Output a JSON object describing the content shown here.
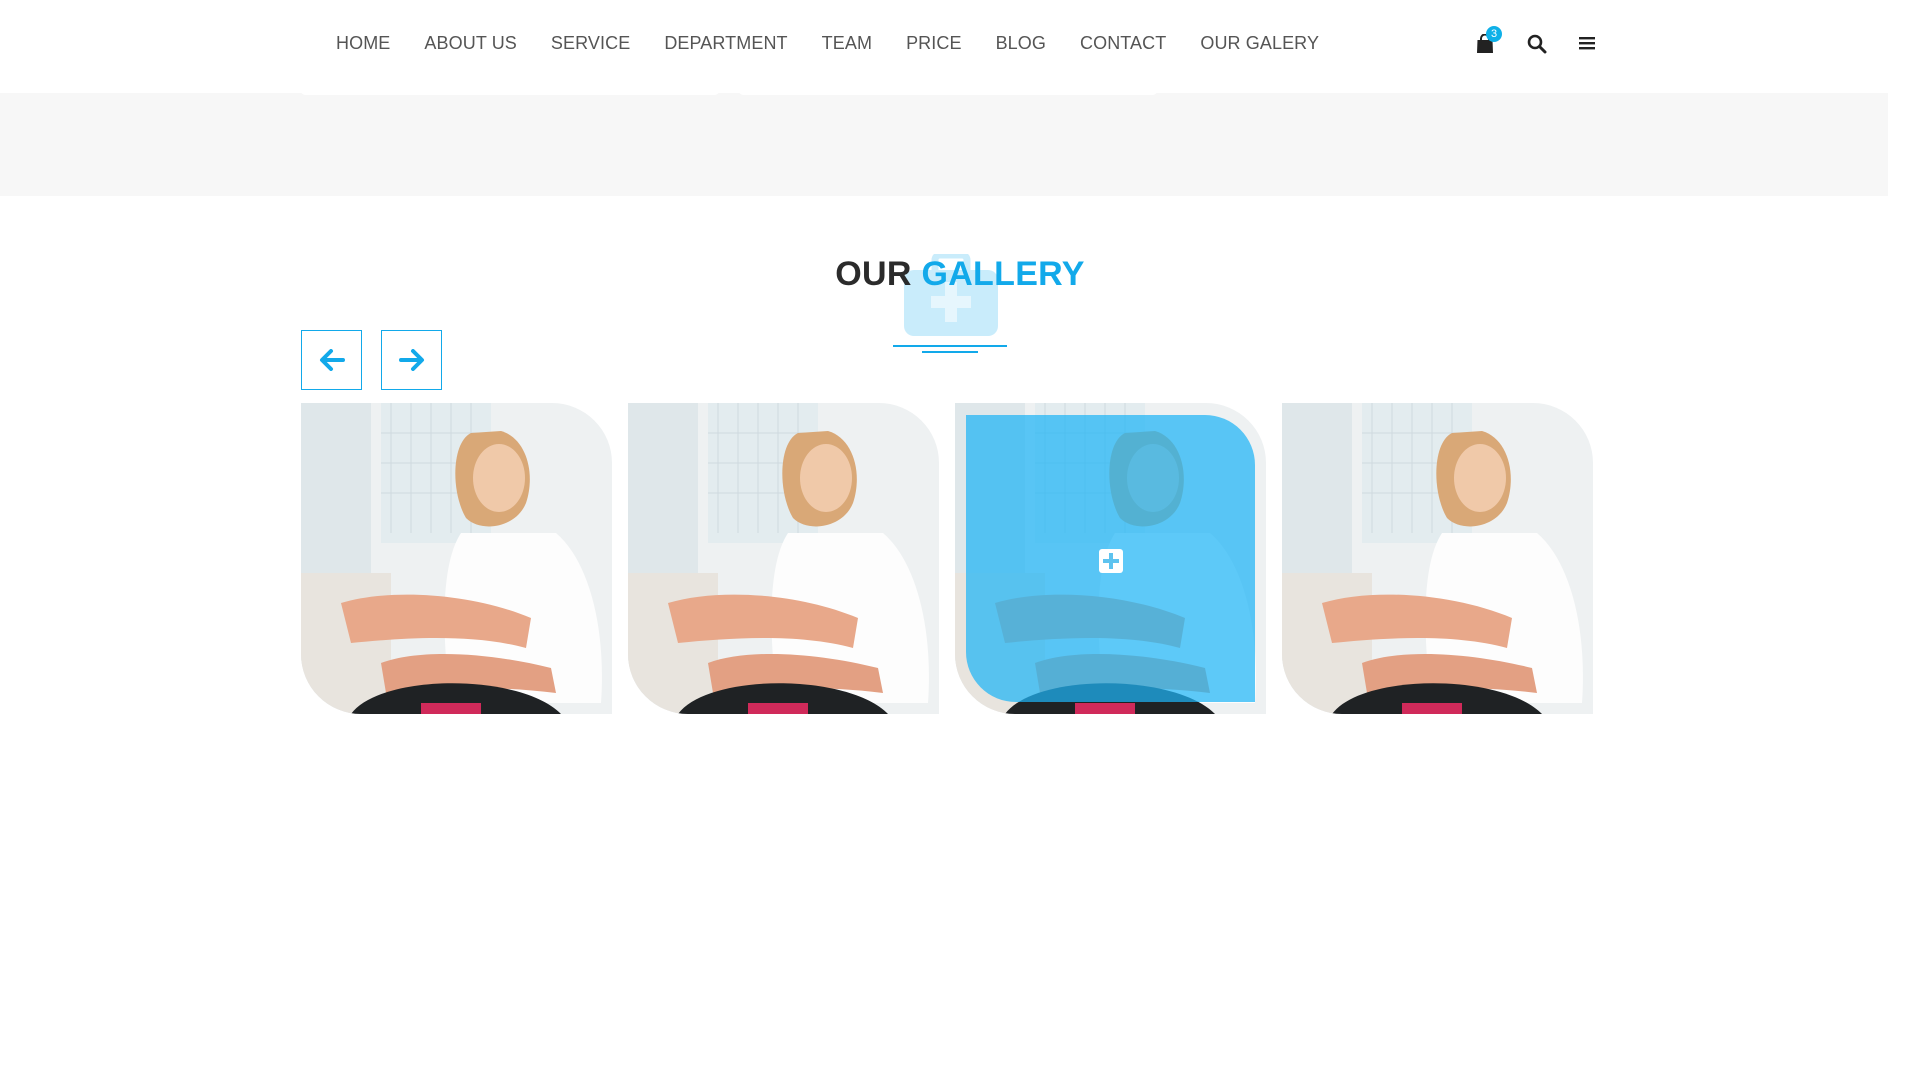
{
  "nav": {
    "items": [
      {
        "label": "HOME"
      },
      {
        "label": "ABOUT US"
      },
      {
        "label": "SERVICE"
      },
      {
        "label": "DEPARTMENT"
      },
      {
        "label": "TEAM"
      },
      {
        "label": "PRICE"
      },
      {
        "label": "BLOG"
      },
      {
        "label": "CONTACT"
      },
      {
        "label": "OUR GALERY"
      }
    ]
  },
  "header": {
    "cart_count": "3",
    "icons": [
      "shopping-bag-icon",
      "search-icon",
      "hamburger-menu-icon"
    ]
  },
  "section": {
    "title_part1": "OUR ",
    "title_part2": "GALLERY",
    "title_icon": "medical-kit-icon"
  },
  "gallery": {
    "prev_icon": "arrow-left-icon",
    "next_icon": "arrow-right-icon",
    "hover_icon": "plus-square-icon",
    "items": [
      {
        "image": "physiotherapy-photo"
      },
      {
        "image": "physiotherapy-photo"
      },
      {
        "image": "physiotherapy-photo",
        "hovered": true
      },
      {
        "image": "physiotherapy-photo"
      }
    ]
  },
  "colors": {
    "accent": "#12a9ea",
    "text_dark": "#2b2b2b",
    "nav_text": "#555555",
    "band_bg": "#f7f7f7"
  }
}
